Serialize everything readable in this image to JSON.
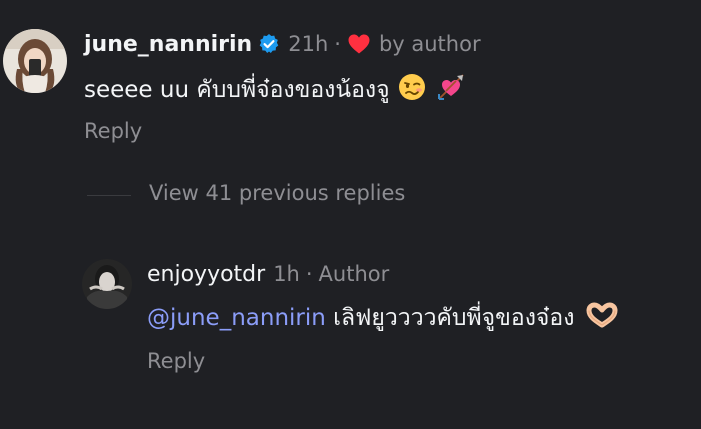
{
  "comment": {
    "username": "june_nannirin",
    "time": "21h",
    "separator": "·",
    "liked_label": "by author",
    "text": "seeee uu คับบพี่จ๋องของน้องจู",
    "reply_label": "Reply",
    "icons": [
      "verified-badge-icon",
      "heart-icon",
      "woozy-face-emoji",
      "heart-with-arrow-emoji"
    ],
    "accent_colors": {
      "verified": "#1d9bf0",
      "heart": "#ff3040"
    }
  },
  "thread": {
    "view_replies_label": "View 41 previous replies"
  },
  "reply": {
    "username": "enjoyyotdr",
    "time": "1h",
    "separator": "·",
    "author_label": "Author",
    "mention": "@june_nannirin",
    "text": " เลิฟยูววววคับพี่จูของจ๋อง",
    "reply_label": "Reply",
    "icons": [
      "heart-hands-emoji"
    ],
    "accent_colors": {
      "mention": "#8b9df8"
    }
  },
  "theme": {
    "background": "#1f2024",
    "primary_text": "#f3f5f7",
    "secondary_text": "#8e8e93"
  }
}
